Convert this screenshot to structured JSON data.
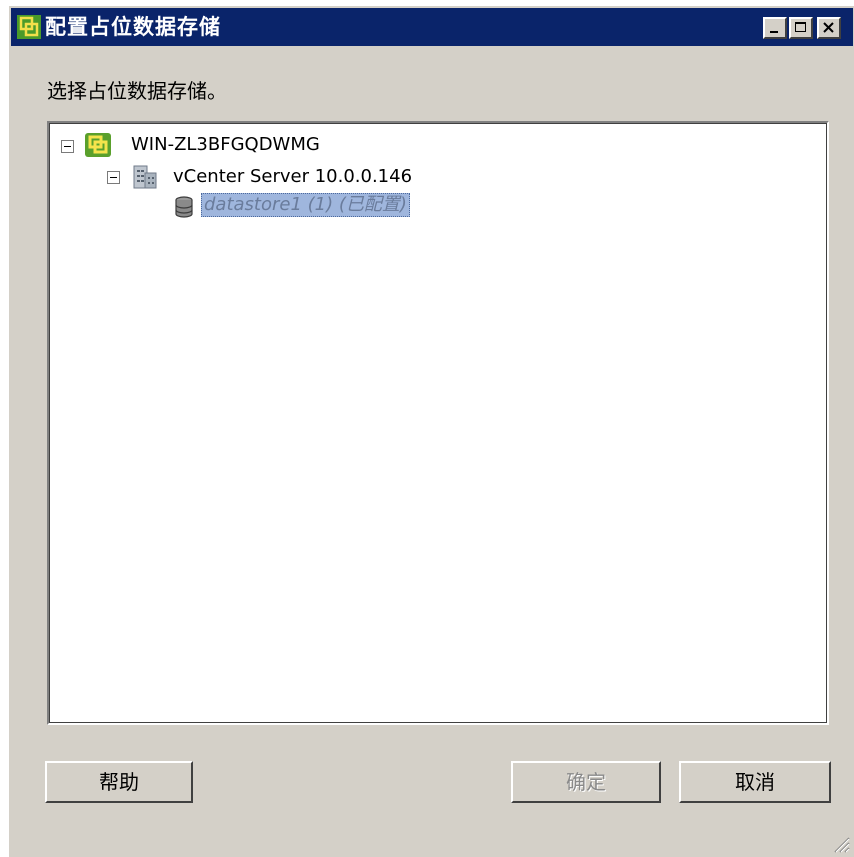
{
  "window": {
    "title": "配置占位数据存储",
    "controls": {
      "minimize_icon": "minimize-icon",
      "maximize_icon": "maximize-icon",
      "close_icon": "close-icon"
    }
  },
  "prompt": "选择占位数据存储。",
  "tree": {
    "nodes": [
      {
        "label": "WIN-ZL3BFGQDWMG",
        "icon": "vsphere-host-icon",
        "expanded": true
      },
      {
        "label": "vCenter Server 10.0.0.146",
        "icon": "vcenter-server-icon",
        "expanded": true
      },
      {
        "label": "datastore1 (1) (已配置)",
        "icon": "datastore-icon",
        "selected": true
      }
    ]
  },
  "buttons": {
    "help": "帮助",
    "ok": "确定",
    "cancel": "取消"
  },
  "colors": {
    "title_bar": "#0a246a",
    "window_bg": "#d4d0c8",
    "selection_bg": "#9fb6dd"
  }
}
